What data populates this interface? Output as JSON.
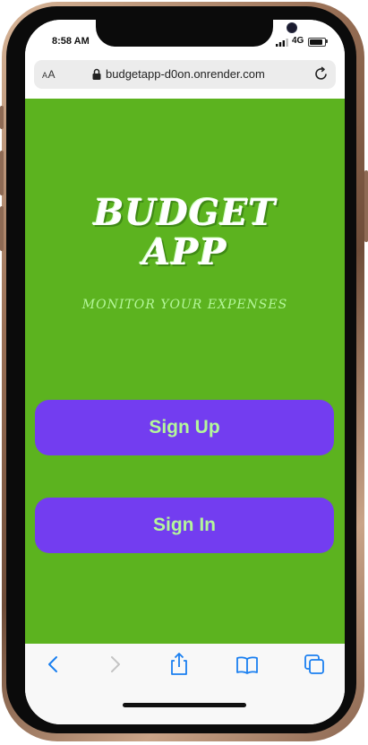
{
  "status_bar": {
    "time": "8:58 AM",
    "network": "4G",
    "battery_level": 0.85
  },
  "browser": {
    "text_size_label_small": "A",
    "text_size_label_large": "A",
    "url": "budgetapp-d0on.onrender.com"
  },
  "app": {
    "title_line1": "BUDGET",
    "title_line2": "APP",
    "tagline": "MONITOR YOUR EXPENSES",
    "signup_label": "Sign Up",
    "signin_label": "Sign In"
  },
  "colors": {
    "background": "#5cb31f",
    "button": "#733df0",
    "button_text": "#b4f79a",
    "tagline": "#b4f79a"
  },
  "toolbar": {
    "icons": [
      "back-icon",
      "forward-icon",
      "share-icon",
      "bookmarks-icon",
      "tabs-icon"
    ]
  }
}
